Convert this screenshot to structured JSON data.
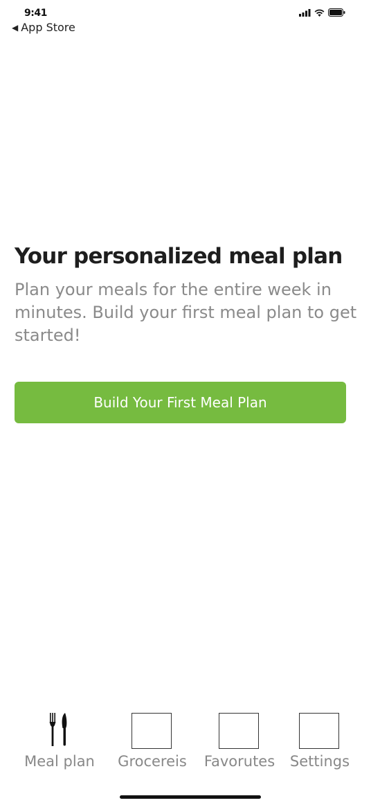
{
  "status_bar": {
    "time": "9:41"
  },
  "nav": {
    "back_label": "App Store"
  },
  "hero": {
    "title": "Your personalized meal plan",
    "subtitle": "Plan your meals for the entire week in minutes. Build your first meal plan to get started!",
    "cta_label": "Build Your First Meal Plan"
  },
  "tab_bar": {
    "items": [
      {
        "label": "Meal plan",
        "icon": "fork-knife-icon",
        "active": true
      },
      {
        "label": "Grocereis",
        "icon": "placeholder-box-icon",
        "active": false
      },
      {
        "label": "Favorutes",
        "icon": "placeholder-box-icon",
        "active": false
      },
      {
        "label": "Settings",
        "icon": "placeholder-box-icon",
        "active": false
      }
    ]
  },
  "colors": {
    "accent": "#76bb40",
    "subtitle_text": "#8a8a8a",
    "tab_label": "#888888"
  }
}
